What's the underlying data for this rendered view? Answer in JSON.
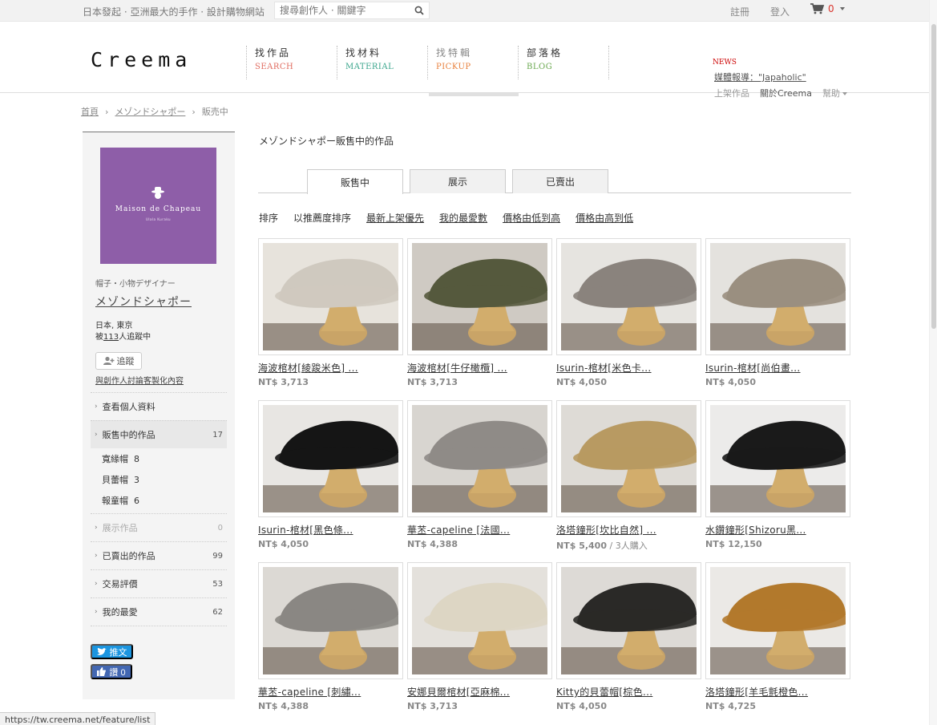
{
  "topbar": {
    "tagline": "日本發起 · 亞洲最大的手作 · 設計購物網站",
    "search_placeholder": "搜尋創作人 · 關鍵字",
    "register": "註冊",
    "login": "登入",
    "cart_count": "0"
  },
  "header": {
    "logo": "Creema",
    "nav": [
      {
        "zh": "找作品",
        "en": "SEARCH",
        "color": "#e06c60"
      },
      {
        "zh": "找材料",
        "en": "MATERIAL",
        "color": "#3aa58c"
      },
      {
        "zh": "找特輯",
        "en": "PICKUP",
        "color": "#e8803c"
      },
      {
        "zh": "部落格",
        "en": "BLOG",
        "color": "#6aa84f"
      }
    ],
    "news_label": "NEWS",
    "news_link": "媒體報導：\"Japaholic\"",
    "links": {
      "sell": "上架作品",
      "about": "關於Creema",
      "help": "幫助"
    }
  },
  "breadcrumb": {
    "home": "首頁",
    "creator": "メゾンドシャポー",
    "current": "販売中"
  },
  "creator": {
    "brand": "Maison de Chapeau",
    "brand_sub": "Ulala Kuraku",
    "role": "帽子・小物デザイナー",
    "name": "メゾンドシャポー",
    "location": "日本, 東京",
    "followed_prefix": "被",
    "followed_count": "113",
    "followed_suffix": "人追蹤中",
    "follow_button": "追蹤",
    "discuss_link": "與創作人討論客製化內容"
  },
  "sidebar_menu": {
    "profile": {
      "label": "查看個人資料"
    },
    "on_sale": {
      "label": "販售中的作品",
      "count": "17"
    },
    "sub": [
      {
        "label": "寬緣帽",
        "count": "8"
      },
      {
        "label": "貝蕾帽",
        "count": "3"
      },
      {
        "label": "報童帽",
        "count": "6"
      }
    ],
    "exhibit": {
      "label": "展示作品",
      "count": "0"
    },
    "sold": {
      "label": "已賣出的作品",
      "count": "99"
    },
    "reviews": {
      "label": "交易評價",
      "count": "53"
    },
    "favorites": {
      "label": "我的最愛",
      "count": "62"
    }
  },
  "social": {
    "tweet": "推文",
    "like": "讚 0"
  },
  "main": {
    "section_title": "メゾンドシャポー販售中的作品",
    "tabs": [
      "販售中",
      "展示",
      "已賣出"
    ],
    "sort": {
      "label": "排序",
      "options": [
        "以推薦度排序",
        "最新上架優先",
        "我的最愛數",
        "價格由低到高",
        "價格由高到低"
      ]
    }
  },
  "products": [
    {
      "title": "海波棺材[綾踆米色] ...",
      "price": "NT$ 3,713",
      "extra": "",
      "bg": "#e7e3dc",
      "hat": "#cfc9bf"
    },
    {
      "title": "海波棺材[牛仔橄欖] ...",
      "price": "NT$ 3,713",
      "extra": "",
      "bg": "#cfcac3",
      "hat": "#55593d"
    },
    {
      "title": "Isurin-棺材[米色卡...",
      "price": "NT$ 4,050",
      "extra": "",
      "bg": "#e6e4e0",
      "hat": "#8a837d"
    },
    {
      "title": "Isurin-棺材[尚伯畫...",
      "price": "NT$ 4,050",
      "extra": "",
      "bg": "#e4e2de",
      "hat": "#9a8f80"
    },
    {
      "title": "Isurin-棺材[黑色條...",
      "price": "NT$ 4,050",
      "extra": "",
      "bg": "#e8e6e3",
      "hat": "#151515"
    },
    {
      "title": "華苤-capeline [法國...",
      "price": "NT$ 4,388",
      "extra": "",
      "bg": "#d8d5d0",
      "hat": "#8f8b87"
    },
    {
      "title": "洛塔鐘形[坎比自然] ...",
      "price": "NT$ 5,400",
      "extra": " / 3人購入",
      "bg": "#dedbd6",
      "hat": "#b89a62"
    },
    {
      "title": "水鑽鐘形[Shizoru黑...",
      "price": "NT$ 12,150",
      "extra": "",
      "bg": "#ecebea",
      "hat": "#1a1a1a"
    },
    {
      "title": "華苤-capeline [刺繡...",
      "price": "NT$ 4,388",
      "extra": "",
      "bg": "#dcd9d4",
      "hat": "#8a8783"
    },
    {
      "title": "安娜貝爾棺材[亞麻棉...",
      "price": "NT$ 3,713",
      "extra": "",
      "bg": "#e4e1dc",
      "hat": "#ddd6c4"
    },
    {
      "title": "Kitty的貝蕾帽[棕色...",
      "price": "NT$ 4,050",
      "extra": "",
      "bg": "#dddad6",
      "hat": "#2a2927"
    },
    {
      "title": "洛塔鐘形[羊毛氈橙色...",
      "price": "NT$ 4,725",
      "extra": "",
      "bg": "#ebe9e6",
      "hat": "#b2792c"
    }
  ],
  "status_url": "https://tw.creema.net/feature/list"
}
